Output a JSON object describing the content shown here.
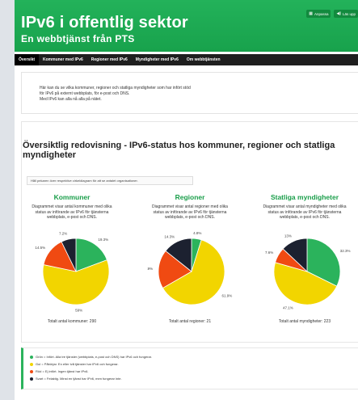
{
  "header": {
    "title": "IPv6 i offentlig sektor",
    "subtitle": "En webbtjänst från PTS",
    "buttons": [
      {
        "label": "Anpassa",
        "icon": "grid-icon"
      },
      {
        "label": "Läs upp",
        "icon": "speaker-icon"
      }
    ]
  },
  "nav": {
    "items": [
      {
        "label": "Översikt",
        "active": true
      },
      {
        "label": "Kommuner med IPv6",
        "active": false
      },
      {
        "label": "Regioner med IPv6",
        "active": false
      },
      {
        "label": "Myndigheter med IPv6",
        "active": false
      },
      {
        "label": "Om webbtjänsten",
        "active": false
      }
    ]
  },
  "intro": {
    "lines": [
      "Här kan du se vilka kommuner, regioner och statliga myndigheter som har infört stöd",
      "för IPv6 på externt webbplats, för e-post och DNS.",
      "Med IPv6 kan alla nå alla på nätet."
    ]
  },
  "overview": {
    "title": "Översiktlig redovisning - IPv6-status hos kommuner, regioner och statliga myndigheter",
    "hint": "Håll pekaren över respektive cirkeldiagram för att se antalet organisationer."
  },
  "colors": {
    "green": "#2bb35c",
    "yellow": "#f2d500",
    "red": "#f04a12",
    "black": "#1c2130"
  },
  "chart_data": [
    {
      "type": "pie",
      "title": "Kommuner",
      "description": "Diagrammet visar antal kommuner med olika status av införande av IPv6 för tjänsterna webbplats, e-post och DNS.",
      "slices": [
        {
          "category": "green",
          "value": 19.3,
          "label": "19.3%"
        },
        {
          "category": "yellow",
          "value": 59,
          "label": "59%"
        },
        {
          "category": "red",
          "value": 14.5,
          "label": "14.5%"
        },
        {
          "category": "black",
          "value": 7.2,
          "label": "7.2%"
        }
      ],
      "total": "Totalt antal kommuner: 290"
    },
    {
      "type": "pie",
      "title": "Regioner",
      "description": "Diagrammet visar antal regioner med olika status av införande av IPv6 för tjänsterna webbplats, e-post och DNS.",
      "slices": [
        {
          "category": "green",
          "value": 4.8,
          "label": "4.8%"
        },
        {
          "category": "yellow",
          "value": 61.9,
          "label": "61.9%"
        },
        {
          "category": "red",
          "value": 19,
          "label": "19%"
        },
        {
          "category": "black",
          "value": 14.3,
          "label": "14.3%"
        }
      ],
      "total": "Totalt antal regioner: 21"
    },
    {
      "type": "pie",
      "title": "Statliga myndigheter",
      "description": "Diagrammet visar antal myndigheter med olika status av införande av IPv6 för tjänsterna webbplats, e-post och DNS.",
      "slices": [
        {
          "category": "green",
          "value": 32.3,
          "label": "32.3%"
        },
        {
          "category": "yellow",
          "value": 47.1,
          "label": "47.1%"
        },
        {
          "category": "red",
          "value": 7.6,
          "label": "7.6%"
        },
        {
          "category": "black",
          "value": 13,
          "label": "13%"
        }
      ],
      "total": "Totalt antal myndigheter: 223"
    }
  ],
  "legend": {
    "items": [
      {
        "color": "green",
        "text": "Grön = Infört. Alla tre tjänster (webbplats, e-post och DNS) har IPv6 och fungerar."
      },
      {
        "color": "yellow",
        "text": "Gul = Påbörjar. En eller två tjänster har IPv6 och fungerar."
      },
      {
        "color": "red",
        "text": "Röd = Ej infört. Ingen tjänst har IPv6."
      },
      {
        "color": "black",
        "text": "Svart = Felaktig. Minst en tjänst har IPv6, men fungerar inte."
      }
    ]
  }
}
